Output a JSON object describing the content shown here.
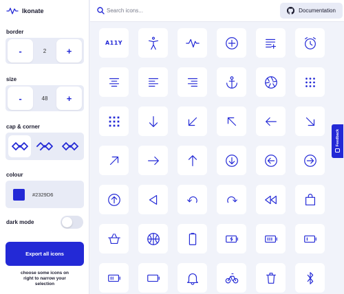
{
  "app": {
    "title": "Ikonate",
    "logo_icon": "activity-icon"
  },
  "sidebar": {
    "border": {
      "label": "border",
      "value": "2",
      "decrement": "-",
      "increment": "+"
    },
    "size": {
      "label": "size",
      "value": "48",
      "decrement": "-",
      "increment": "+"
    },
    "cap_corner": {
      "label": "cap & corner",
      "options": [
        "round-round",
        "square-round",
        "round-square"
      ],
      "selected": 0
    },
    "colour": {
      "label": "colour",
      "hex": "#2329D6"
    },
    "dark_mode": {
      "label": "dark mode",
      "enabled": false
    },
    "export_label": "Export all icons",
    "hint": "choose some icons on right to narrow your selection"
  },
  "search": {
    "placeholder": "Search icons...",
    "value": ""
  },
  "docs_label": "Documentation",
  "feedback_label": "Feedback",
  "accent_color": "#2329D6",
  "icons": [
    {
      "name": "a11y",
      "text": "A11Y"
    },
    {
      "name": "accessibility"
    },
    {
      "name": "activity"
    },
    {
      "name": "add"
    },
    {
      "name": "add-to-list"
    },
    {
      "name": "alarm"
    },
    {
      "name": "align-center"
    },
    {
      "name": "align-left"
    },
    {
      "name": "align-right"
    },
    {
      "name": "anchor"
    },
    {
      "name": "aperture"
    },
    {
      "name": "apps"
    },
    {
      "name": "apps-alt"
    },
    {
      "name": "arrow-down"
    },
    {
      "name": "arrow-down-left"
    },
    {
      "name": "arrow-up-left"
    },
    {
      "name": "arrow-left"
    },
    {
      "name": "arrow-down-right"
    },
    {
      "name": "arrow-up-right"
    },
    {
      "name": "arrow-right"
    },
    {
      "name": "arrow-up"
    },
    {
      "name": "arrow-down-circle"
    },
    {
      "name": "arrow-left-circle"
    },
    {
      "name": "arrow-right-circle"
    },
    {
      "name": "arrow-up-circle"
    },
    {
      "name": "back"
    },
    {
      "name": "back-alt"
    },
    {
      "name": "forward-alt"
    },
    {
      "name": "rewind"
    },
    {
      "name": "bag"
    },
    {
      "name": "basket"
    },
    {
      "name": "basketball"
    },
    {
      "name": "battery"
    },
    {
      "name": "battery-charging"
    },
    {
      "name": "battery-full"
    },
    {
      "name": "battery-low"
    },
    {
      "name": "battery-medium"
    },
    {
      "name": "battery-empty"
    },
    {
      "name": "bell"
    },
    {
      "name": "bicycle"
    },
    {
      "name": "bin"
    },
    {
      "name": "bluetooth"
    }
  ]
}
